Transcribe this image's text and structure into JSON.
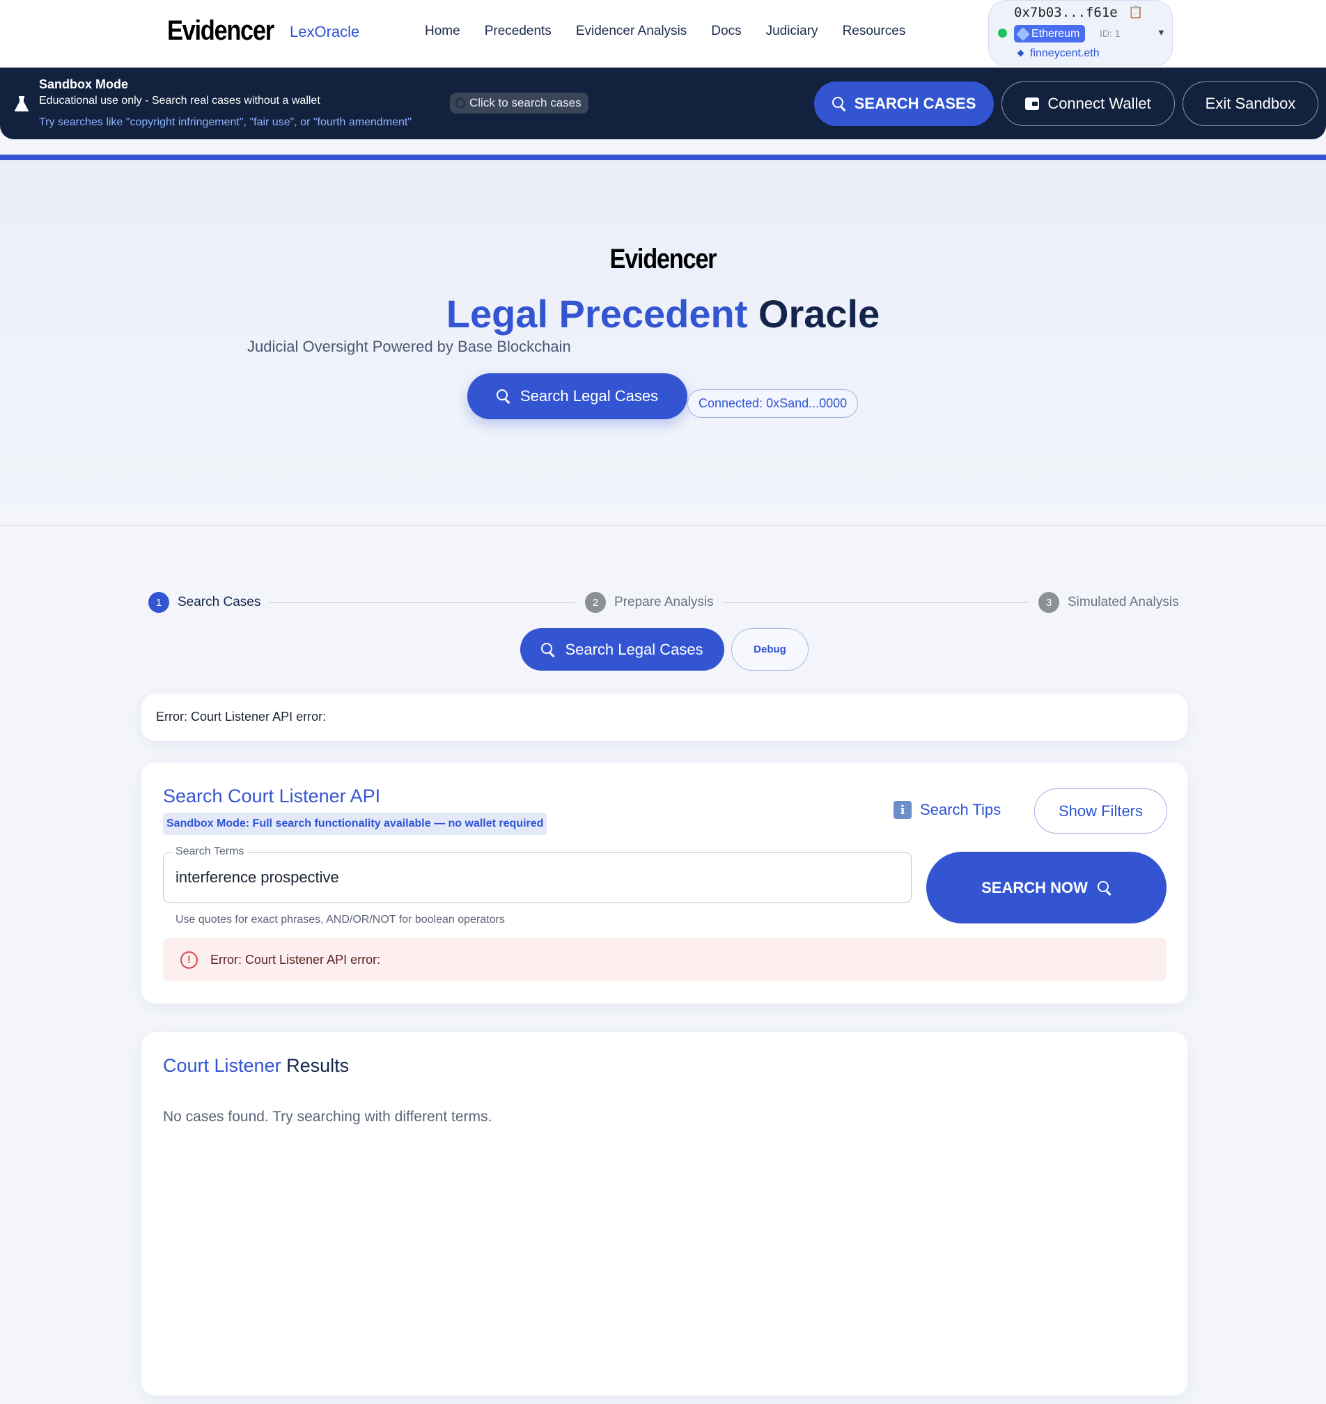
{
  "nav": {
    "logo": "Evidencer",
    "brand": "LexOracle",
    "links": [
      "Home",
      "Precedents",
      "Evidencer Analysis",
      "Docs",
      "Judiciary",
      "Resources"
    ]
  },
  "wallet": {
    "address": "0x7b03...f61e",
    "chain": "Ethereum",
    "chain_id": "ID: 1",
    "ens": "finneycent.eth",
    "status_color": "#21c25e"
  },
  "sandbox": {
    "title": "Sandbox Mode",
    "subtitle": "Educational use only - Search real cases without a wallet",
    "hint": "Try searches like \"copyright infringement\", \"fair use\", or \"fourth amendment\"",
    "search_pill": "Click to search cases",
    "search_cases_label": "SEARCH CASES",
    "connect_wallet_label": "Connect Wallet",
    "exit_label": "Exit Sandbox"
  },
  "hero": {
    "logo": "Evidencer",
    "title_part1": "Legal Precedent",
    "title_part2": "Oracle",
    "subtitle": "Judicial Oversight Powered by Base Blockchain",
    "search_button": "Search Legal Cases",
    "connected": "Connected: 0xSand...0000"
  },
  "stepper": {
    "steps": [
      {
        "num": "1",
        "label": "Search Cases"
      },
      {
        "num": "2",
        "label": "Prepare Analysis"
      },
      {
        "num": "3",
        "label": "Simulated Analysis"
      }
    ],
    "active_step": 1,
    "search_button": "Search Legal Cases",
    "debug_button": "Debug"
  },
  "error_banner": {
    "text": "Error: Court Listener API error:"
  },
  "search_card": {
    "title": "Search Court Listener API",
    "badge": "Sandbox Mode: Full search functionality available — no wallet required",
    "tips_label": "Search Tips",
    "filters_label": "Show Filters",
    "field_label": "Search Terms",
    "field_value": "interference prospective",
    "help_text": "Use quotes for exact phrases, AND/OR/NOT for boolean operators",
    "search_now_label": "SEARCH NOW",
    "error_text": "Error: Court Listener API error:"
  },
  "results_card": {
    "title_part1": "Court Listener",
    "title_part2": "Results",
    "empty_text": "No cases found. Try searching with different terms."
  },
  "colors": {
    "accent": "#3355d1",
    "navy": "#12223e",
    "error_bg": "#fdefef",
    "error_icon": "#d94b4b"
  }
}
